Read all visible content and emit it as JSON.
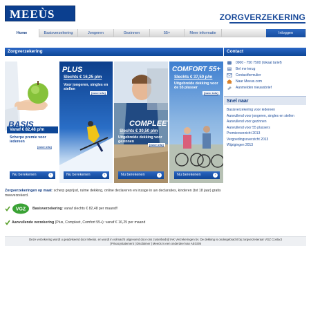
{
  "header": {
    "logo_text": "MEEÙS",
    "brand_title": "ZORGVERZEKERING"
  },
  "nav": {
    "items": [
      {
        "label": "Home",
        "active": true
      },
      {
        "label": "Basisverzekering"
      },
      {
        "label": "Jongeren"
      },
      {
        "label": "Gezinnen"
      },
      {
        "label": "55+"
      },
      {
        "label": "Meer informatie"
      }
    ],
    "login_label": "Inloggen"
  },
  "main": {
    "title": "Zorgverzekering",
    "panels": [
      {
        "title": "BASIS",
        "price": "Vanaf  € 82,48 p/m",
        "description": "Scherpe premie voor iedereen",
        "more": "[meer info]",
        "cta": "Nu berekenen"
      },
      {
        "title": "PLUS",
        "price": "Slechts € 16,25 p/m",
        "description": "Voor jongeren, singles en stellen",
        "more": "[meer info]",
        "cta": "Nu berekenen"
      },
      {
        "title": "COMPLEET",
        "price": "Slechts € 30,50 p/m",
        "description": "Uitgebreide dekking voor gezinnen",
        "more": "[meer info]",
        "cta": "Nu berekenen"
      },
      {
        "title": "COMFORT 55+",
        "price": "Slechts € 37,50 p/m",
        "description": "Uitgebreide dekking voor de 55 plusser",
        "more": "[meer info]",
        "cta": "Nu berekenen"
      }
    ]
  },
  "contact": {
    "title": "Contact",
    "items": [
      {
        "icon": "phone-icon",
        "label": "0900 - 750 7500 (lokaal tarief)"
      },
      {
        "icon": "callback-icon",
        "label": "Bel me terug"
      },
      {
        "icon": "form-icon",
        "label": "Contactformulier"
      },
      {
        "icon": "home-icon",
        "label": "Naar Meeus.com"
      },
      {
        "icon": "newsletter-icon",
        "label": "Aanmelden nieuwsbrief"
      }
    ]
  },
  "snel": {
    "title": "Snel naar",
    "items": [
      "Basisverzekering voor iedereen",
      "Aanvullend voor jongeren, singles en stellen",
      "Aanvullend voor gezinnen",
      "Aanvullend voor 55 plussers",
      "Premieoverzicht 2013",
      "Vergoedingsoverzicht 2013",
      "Wijzigingen 2013"
    ]
  },
  "info": {
    "bold": "Zorgverzekeringen op maat",
    "text": ": scherp geprijsd, ruime dekking, online declareren en inzage in uw declaraties, kinderen (tot 18 jaar) gratis meeverzekerd.",
    "vgz_logo": "VGZ",
    "basis_bold": "Basisverzekering",
    "basis_text": ": vanaf slechts € 82,48 per maand!!",
    "aanv_bold": "Aanvullende verzekering",
    "aanv_text": " (Plus, Compleet, Comfort 55+): vanaf € 16,25 per maand"
  },
  "footer": {
    "line1": "Deze verzekering wordt u geadviseerd door Meeùs. en wordt in volmacht uitgevoerd door ons zusterbedrijf IAK Verzekeringen bv. De dekking is ondergebracht bij zorgverzekeraar VGZ  Contact",
    "line2": "| Privacystatement | Disclaimer | Meeùs is een onderdeel van AEGON"
  },
  "colors": {
    "brand_blue": "#1b4b9a",
    "header_blue": "#0d4696",
    "green_check": "#5aa02c"
  }
}
